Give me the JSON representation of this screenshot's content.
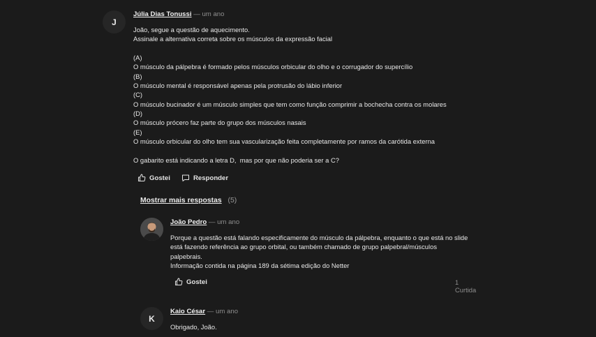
{
  "comments": [
    {
      "avatar_letter": "J",
      "author": "Júlia Dias Tonussi",
      "time": "— um ano",
      "body": "João, segue a questão de aquecimento.\nAssinale a alternativa correta sobre os músculos da expressão facial\n\n(A)\nO músculo da pálpebra é formado pelos músculos orbicular do olho e o corrugador do supercílio\n(B)\nO músculo mental é responsável apenas pela protrusão do lábio inferior\n(C)\nO músculo bucinador é um músculo simples que tem como função comprimir a bochecha contra os molares\n(D)\nO músculo prócero faz parte do grupo dos músculos nasais\n(E)\nO músculo orbicular do olho tem sua vascularização feita completamente por ramos da carótida externa\n\nO gabarito está indicando a letra D,  mas por que não poderia ser a C?",
      "like_label": "Gostei",
      "reply_label": "Responder"
    },
    {
      "author": "João Pedro",
      "time": "— um ano",
      "body": "Porque a questão está falando especificamente do músculo da pálpebra, enquanto o que está no slide\nestá fazendo referência ao grupo orbital, ou também chamado de grupo palpebral/músculos\npalpebrais.\nInformação contida na página 189 da sétima edição do Netter",
      "like_label": "Gostei",
      "reactions": "1 Curtida"
    },
    {
      "avatar_letter": "K",
      "author": "Kaio César",
      "time": "— um ano",
      "body": "Obrigado, João."
    }
  ],
  "show_more": {
    "label": "Mostrar mais respostas",
    "count": "(5)"
  },
  "icons": {
    "like": "thumbs-up-icon",
    "reply": "speech-bubble-icon"
  }
}
